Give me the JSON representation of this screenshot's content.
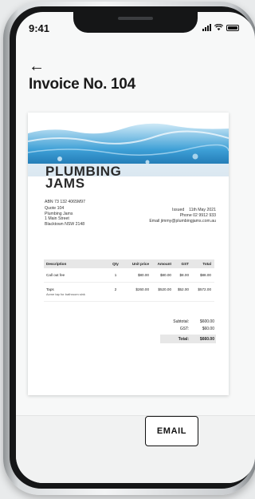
{
  "status_bar": {
    "time": "9:41"
  },
  "header": {
    "back_icon": "arrow-left-icon",
    "title": "Invoice No. 104"
  },
  "invoice": {
    "brand_line1": "PLUMBING",
    "brand_line2": "JAMS",
    "abn": "ABN 73 132 4065M97",
    "quote": "Quote 104",
    "company_name": "Plumbing Jams",
    "company_street": "1 Main Street",
    "company_suburb": "Blacktown NSW 2148",
    "issued": "Issued    11th May 2021",
    "phone": "Phone 02 9912 933",
    "email": "Email jimmy@plumbingjams.com.au",
    "columns": [
      "Description",
      "Qty",
      "Unit price",
      "Amount",
      "GST",
      "Total"
    ],
    "rows": [
      {
        "description": "Call out fee",
        "sub": "",
        "qty": "1",
        "unit_price": "$80.00",
        "amount": "$80.00",
        "gst": "$8.00",
        "total": "$88.00"
      },
      {
        "description": "Taps",
        "sub": "Acme tap for bathroom sink",
        "qty": "2",
        "unit_price": "$260.00",
        "amount": "$520.00",
        "gst": "$52.00",
        "total": "$572.00"
      }
    ],
    "subtotal_label": "Subtotal:",
    "subtotal_value": "$600.00",
    "gst_label": "GST:",
    "gst_value": "$60.00",
    "total_label": "Total:",
    "total_value": "$660.00"
  },
  "actions": {
    "email_label": "EMAIL"
  }
}
